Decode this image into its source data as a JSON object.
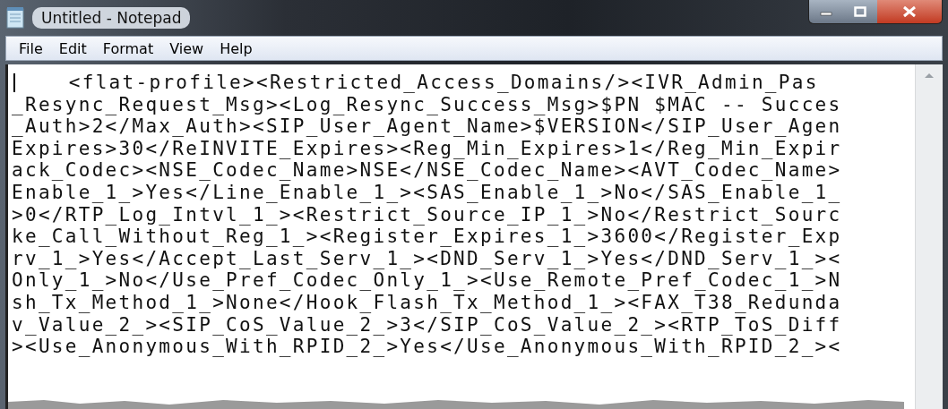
{
  "window": {
    "title": "Untitled - Notepad"
  },
  "menu": [
    "File",
    "Edit",
    "Format",
    "View",
    "Help"
  ],
  "editor": {
    "lines": [
      "\t<flat-profile><Restricted_Access_Domains/><IVR_Admin_Pas",
      "_Resync_Request_Msg><Log_Resync_Success_Msg>$PN $MAC -- Succes",
      "_Auth>2</Max_Auth><SIP_User_Agent_Name>$VERSION</SIP_User_Agen",
      "Expires>30</ReINVITE_Expires><Reg_Min_Expires>1</Reg_Min_Expir",
      "ack_Codec><NSE_Codec_Name>NSE</NSE_Codec_Name><AVT_Codec_Name>",
      "Enable_1_>Yes</Line_Enable_1_><SAS_Enable_1_>No</SAS_Enable_1_",
      ">0</RTP_Log_Intvl_1_><Restrict_Source_IP_1_>No</Restrict_Sourc",
      "ke_Call_Without_Reg_1_><Register_Expires_1_>3600</Register_Exp",
      "rv_1_>Yes</Accept_Last_Serv_1_><DND_Serv_1_>Yes</DND_Serv_1_><",
      "Only_1_>No</Use_Pref_Codec_Only_1_><Use_Remote_Pref_Codec_1_>N",
      "sh_Tx_Method_1_>None</Hook_Flash_Tx_Method_1_><FAX_T38_Redunda",
      "v_Value_2_><SIP_CoS_Value_2_>3</SIP_CoS_Value_2_><RTP_ToS_Diff",
      "><Use_Anonymous_With_RPID_2_>Yes</Use_Anonymous_With_RPID_2_><"
    ]
  }
}
